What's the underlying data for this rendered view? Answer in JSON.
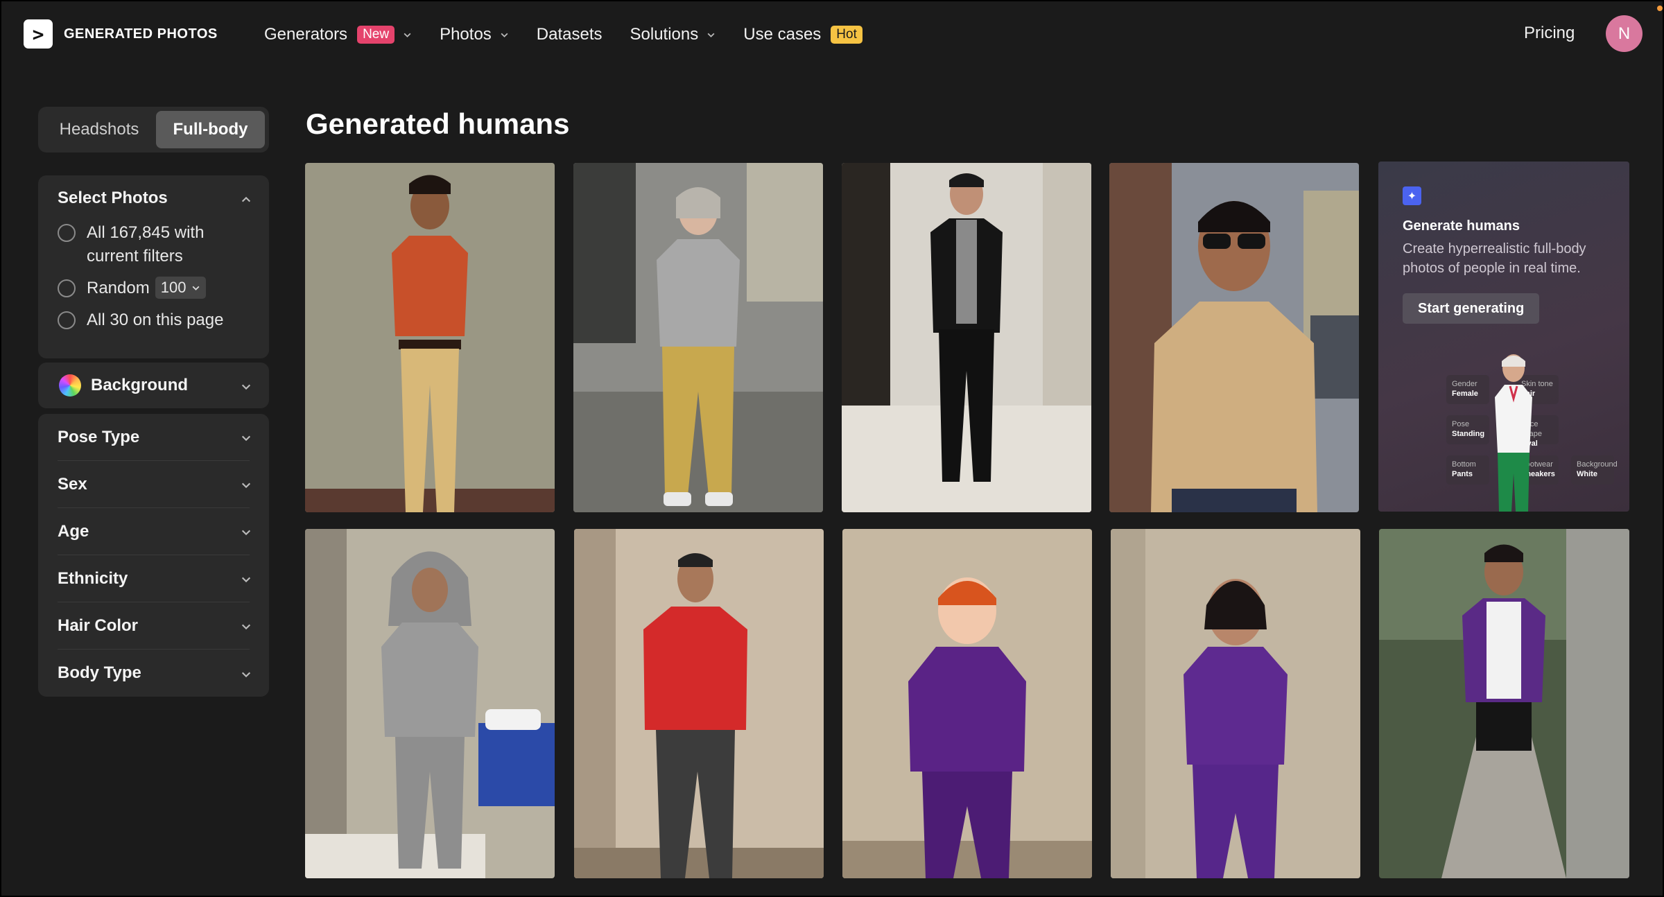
{
  "header": {
    "logo_text": "GENERATED PHOTOS",
    "logo_glyph": ">",
    "nav": [
      {
        "label": "Generators",
        "badge": "New",
        "dropdown": true
      },
      {
        "label": "Photos",
        "badge": "",
        "dropdown": true
      },
      {
        "label": "Datasets",
        "badge": "",
        "dropdown": false
      },
      {
        "label": "Solutions",
        "badge": "",
        "dropdown": true
      },
      {
        "label": "Use cases",
        "badge": "Hot",
        "dropdown": false
      }
    ],
    "pricing": "Pricing",
    "avatar_initial": "N"
  },
  "sidebar": {
    "toggle": {
      "headshots": "Headshots",
      "fullbody": "Full-body",
      "active": "Full-body"
    },
    "select_photos": {
      "title": "Select Photos",
      "option_all": "All 167,845 with current filters",
      "option_random": "Random",
      "random_count": "100",
      "option_page": "All 30 on this page"
    },
    "background": "Background",
    "filters": [
      "Pose Type",
      "Sex",
      "Age",
      "Ethnicity",
      "Hair Color",
      "Body Type"
    ]
  },
  "main": {
    "title": "Generated humans",
    "promo": {
      "title": "Generate humans",
      "text": "Create hyperrealistic full-body photos of people in real time.",
      "button": "Start generating",
      "chips": [
        {
          "k": "Gender",
          "v": "Female"
        },
        {
          "k": "Skin tone",
          "v": "Fair"
        },
        {
          "k": "Pose",
          "v": "Standing"
        },
        {
          "k": "Face shape",
          "v": "Oval"
        },
        {
          "k": "Bottom",
          "v": "Pants"
        },
        {
          "k": "Footwear",
          "v": "Sneakers"
        },
        {
          "k": "Background",
          "v": "White"
        }
      ]
    },
    "photos": [
      {
        "subject": "young man in orange shirt and khaki pants"
      },
      {
        "subject": "older woman in grey hoodie and yellow cargo pants"
      },
      {
        "subject": "man in black suit in hallway"
      },
      {
        "subject": "man in tan shirt with sunglasses on street"
      },
      {
        "subject": "man in grey hoodie in hospital room"
      },
      {
        "subject": "man in red shirt by wall"
      },
      {
        "subject": "red-haired child in purple hoodie"
      },
      {
        "subject": "girl in purple jumpsuit"
      },
      {
        "subject": "man in purple shirt and black shorts on path"
      }
    ]
  },
  "colors": {
    "background": "#1b1b1b",
    "panel": "#2a2a2a",
    "badge_new": "#e5436c",
    "badge_hot": "#f6c343",
    "avatar": "#d9789e"
  }
}
